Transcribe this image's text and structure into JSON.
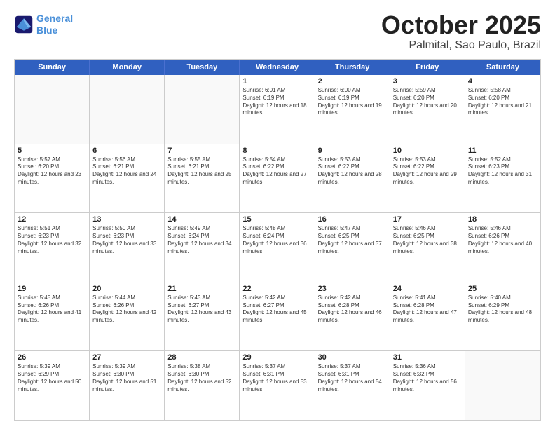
{
  "header": {
    "logo": {
      "line1": "General",
      "line2": "Blue"
    },
    "title": "October 2025",
    "location": "Palmital, Sao Paulo, Brazil"
  },
  "days_of_week": [
    "Sunday",
    "Monday",
    "Tuesday",
    "Wednesday",
    "Thursday",
    "Friday",
    "Saturday"
  ],
  "weeks": [
    [
      {
        "day": "",
        "empty": true
      },
      {
        "day": "",
        "empty": true
      },
      {
        "day": "",
        "empty": true
      },
      {
        "day": "1",
        "sunrise": "6:01 AM",
        "sunset": "6:19 PM",
        "daylight": "12 hours and 18 minutes."
      },
      {
        "day": "2",
        "sunrise": "6:00 AM",
        "sunset": "6:19 PM",
        "daylight": "12 hours and 19 minutes."
      },
      {
        "day": "3",
        "sunrise": "5:59 AM",
        "sunset": "6:20 PM",
        "daylight": "12 hours and 20 minutes."
      },
      {
        "day": "4",
        "sunrise": "5:58 AM",
        "sunset": "6:20 PM",
        "daylight": "12 hours and 21 minutes."
      }
    ],
    [
      {
        "day": "5",
        "sunrise": "5:57 AM",
        "sunset": "6:20 PM",
        "daylight": "12 hours and 23 minutes."
      },
      {
        "day": "6",
        "sunrise": "5:56 AM",
        "sunset": "6:21 PM",
        "daylight": "12 hours and 24 minutes."
      },
      {
        "day": "7",
        "sunrise": "5:55 AM",
        "sunset": "6:21 PM",
        "daylight": "12 hours and 25 minutes."
      },
      {
        "day": "8",
        "sunrise": "5:54 AM",
        "sunset": "6:22 PM",
        "daylight": "12 hours and 27 minutes."
      },
      {
        "day": "9",
        "sunrise": "5:53 AM",
        "sunset": "6:22 PM",
        "daylight": "12 hours and 28 minutes."
      },
      {
        "day": "10",
        "sunrise": "5:53 AM",
        "sunset": "6:22 PM",
        "daylight": "12 hours and 29 minutes."
      },
      {
        "day": "11",
        "sunrise": "5:52 AM",
        "sunset": "6:23 PM",
        "daylight": "12 hours and 31 minutes."
      }
    ],
    [
      {
        "day": "12",
        "sunrise": "5:51 AM",
        "sunset": "6:23 PM",
        "daylight": "12 hours and 32 minutes."
      },
      {
        "day": "13",
        "sunrise": "5:50 AM",
        "sunset": "6:23 PM",
        "daylight": "12 hours and 33 minutes."
      },
      {
        "day": "14",
        "sunrise": "5:49 AM",
        "sunset": "6:24 PM",
        "daylight": "12 hours and 34 minutes."
      },
      {
        "day": "15",
        "sunrise": "5:48 AM",
        "sunset": "6:24 PM",
        "daylight": "12 hours and 36 minutes."
      },
      {
        "day": "16",
        "sunrise": "5:47 AM",
        "sunset": "6:25 PM",
        "daylight": "12 hours and 37 minutes."
      },
      {
        "day": "17",
        "sunrise": "5:46 AM",
        "sunset": "6:25 PM",
        "daylight": "12 hours and 38 minutes."
      },
      {
        "day": "18",
        "sunrise": "5:46 AM",
        "sunset": "6:26 PM",
        "daylight": "12 hours and 40 minutes."
      }
    ],
    [
      {
        "day": "19",
        "sunrise": "5:45 AM",
        "sunset": "6:26 PM",
        "daylight": "12 hours and 41 minutes."
      },
      {
        "day": "20",
        "sunrise": "5:44 AM",
        "sunset": "6:26 PM",
        "daylight": "12 hours and 42 minutes."
      },
      {
        "day": "21",
        "sunrise": "5:43 AM",
        "sunset": "6:27 PM",
        "daylight": "12 hours and 43 minutes."
      },
      {
        "day": "22",
        "sunrise": "5:42 AM",
        "sunset": "6:27 PM",
        "daylight": "12 hours and 45 minutes."
      },
      {
        "day": "23",
        "sunrise": "5:42 AM",
        "sunset": "6:28 PM",
        "daylight": "12 hours and 46 minutes."
      },
      {
        "day": "24",
        "sunrise": "5:41 AM",
        "sunset": "6:28 PM",
        "daylight": "12 hours and 47 minutes."
      },
      {
        "day": "25",
        "sunrise": "5:40 AM",
        "sunset": "6:29 PM",
        "daylight": "12 hours and 48 minutes."
      }
    ],
    [
      {
        "day": "26",
        "sunrise": "5:39 AM",
        "sunset": "6:29 PM",
        "daylight": "12 hours and 50 minutes."
      },
      {
        "day": "27",
        "sunrise": "5:39 AM",
        "sunset": "6:30 PM",
        "daylight": "12 hours and 51 minutes."
      },
      {
        "day": "28",
        "sunrise": "5:38 AM",
        "sunset": "6:30 PM",
        "daylight": "12 hours and 52 minutes."
      },
      {
        "day": "29",
        "sunrise": "5:37 AM",
        "sunset": "6:31 PM",
        "daylight": "12 hours and 53 minutes."
      },
      {
        "day": "30",
        "sunrise": "5:37 AM",
        "sunset": "6:31 PM",
        "daylight": "12 hours and 54 minutes."
      },
      {
        "day": "31",
        "sunrise": "5:36 AM",
        "sunset": "6:32 PM",
        "daylight": "12 hours and 56 minutes."
      },
      {
        "day": "",
        "empty": true
      }
    ]
  ]
}
